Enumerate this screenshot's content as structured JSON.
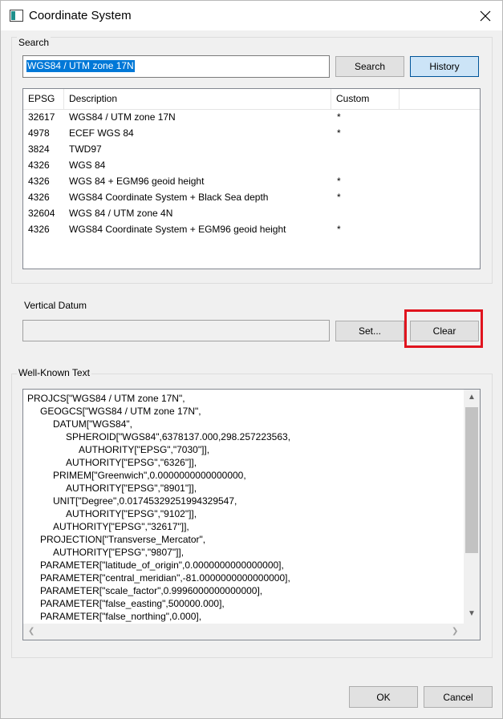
{
  "window": {
    "title": "Coordinate System"
  },
  "search": {
    "group_label": "Search",
    "input_value": "WGS84 / UTM zone 17N",
    "search_label": "Search",
    "history_label": "History"
  },
  "results": {
    "columns": [
      "EPSG",
      "Description",
      "Custom"
    ],
    "rows": [
      {
        "epsg": "32617",
        "description": "WGS84 / UTM zone 17N",
        "custom": "*"
      },
      {
        "epsg": "4978",
        "description": "ECEF WGS 84",
        "custom": "*"
      },
      {
        "epsg": "3824",
        "description": "TWD97",
        "custom": ""
      },
      {
        "epsg": "4326",
        "description": "WGS 84",
        "custom": ""
      },
      {
        "epsg": "4326",
        "description": "WGS 84 + EGM96 geoid height",
        "custom": "*"
      },
      {
        "epsg": "4326",
        "description": "WGS84 Coordinate System + Black Sea depth",
        "custom": "*"
      },
      {
        "epsg": "32604",
        "description": "WGS 84 / UTM zone 4N",
        "custom": ""
      },
      {
        "epsg": "4326",
        "description": "WGS84 Coordinate System + EGM96 geoid height",
        "custom": "*"
      }
    ]
  },
  "vertical_datum": {
    "label": "Vertical Datum",
    "value": "",
    "set_label": "Set...",
    "clear_label": "Clear"
  },
  "wkt": {
    "group_label": "Well-Known Text",
    "lines": [
      "PROJCS[\"WGS84 / UTM zone 17N\",",
      "GEOGCS[\"WGS84 / UTM zone 17N\",",
      "DATUM[\"WGS84\",",
      "SPHEROID[\"WGS84\",6378137.000,298.257223563,",
      "AUTHORITY[\"EPSG\",\"7030\"]],",
      "AUTHORITY[\"EPSG\",\"6326\"]],",
      "PRIMEM[\"Greenwich\",0.0000000000000000,",
      "AUTHORITY[\"EPSG\",\"8901\"]],",
      "UNIT[\"Degree\",0.0174532925199432954​7,",
      "AUTHORITY[\"EPSG\",\"9102\"]],",
      "AUTHORITY[\"EPSG\",\"32617\"]],",
      "PROJECTION[\"Transverse_Mercator\",",
      "AUTHORITY[\"EPSG\",\"9807\"]],",
      "PARAMETER[\"latitude_of_origin\",0.0000000000000000],",
      "PARAMETER[\"central_meridian\",-81.0000000000000000],",
      "PARAMETER[\"scale_factor\",0.9996000000000000],",
      "PARAMETER[\"false_easting\",500000.000],",
      "PARAMETER[\"false_northing\",0.000],"
    ]
  },
  "footer": {
    "ok_label": "OK",
    "cancel_label": "Cancel"
  },
  "colors": {
    "selection": "#0078d7",
    "highlight_box": "#e0141e",
    "active_button": "#cce4f7"
  }
}
